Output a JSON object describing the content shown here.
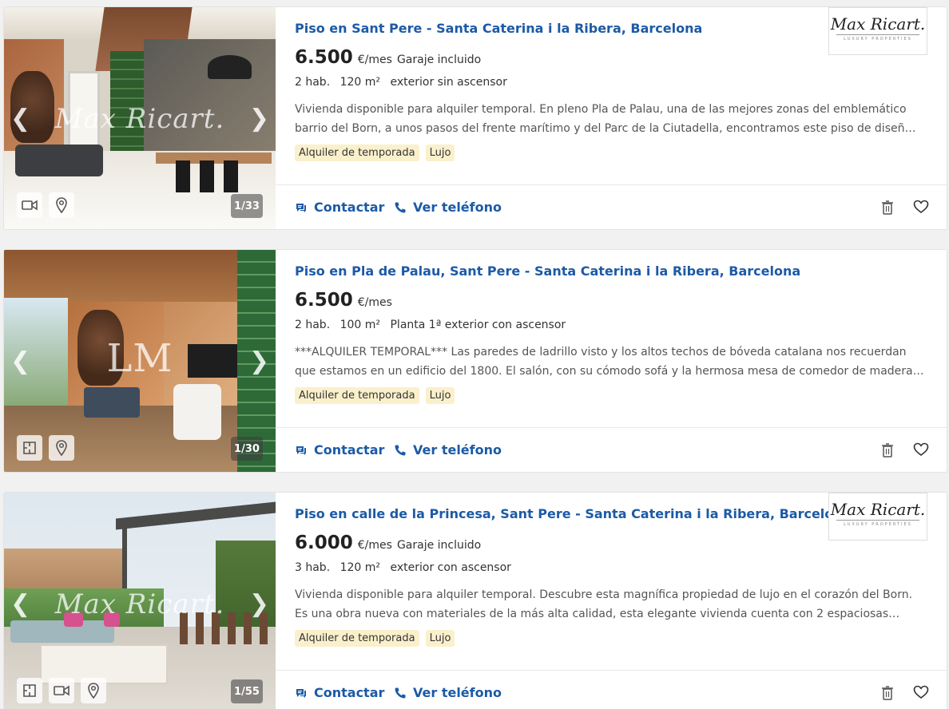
{
  "listings": [
    {
      "title": "Piso en Sant Pere - Santa Caterina i la Ribera, Barcelona",
      "price": "6.500",
      "price_unit": "€/mes",
      "price_extra": "Garaje incluido",
      "details": [
        "2 hab.",
        "120 m²",
        "exterior sin ascensor"
      ],
      "description": "Vivienda disponible para alquiler temporal. En pleno Pla de Palau, una de las mejores zonas del emblemático barrio del Born, a unos pasos del frente marítimo y del Parc de la Ciutadella, encontramos este piso de diseñ…",
      "tags": [
        "Alquiler de temporada",
        "Lujo"
      ],
      "photo_counter": "1/33",
      "watermark": "Max Ricart.",
      "logo": {
        "name": "Max Ricart.",
        "tagline": "LUXURY PROPERTIES"
      },
      "photo_icons": [
        "video-icon",
        "map-pin-icon"
      ]
    },
    {
      "title": "Piso en Pla de Palau, Sant Pere - Santa Caterina i la Ribera, Barcelona",
      "price": "6.500",
      "price_unit": "€/mes",
      "price_extra": "",
      "details": [
        "2 hab.",
        "100 m²",
        "Planta 1ª exterior con ascensor"
      ],
      "description": "***ALQUILER TEMPORAL*** Las paredes de ladrillo visto y los altos techos de bóveda catalana nos recuerdan que estamos en un edificio del 1800. El salón, con su cómodo sofá y la hermosa mesa de comedor de madera…",
      "tags": [
        "Alquiler de temporada",
        "Lujo"
      ],
      "photo_counter": "1/30",
      "watermark": "LM",
      "logo": null,
      "photo_icons": [
        "floor-plan-icon",
        "map-pin-icon"
      ]
    },
    {
      "title": "Piso en calle de la Princesa, Sant Pere - Santa Caterina i la Ribera, Barcelona",
      "price": "6.000",
      "price_unit": "€/mes",
      "price_extra": "Garaje incluido",
      "details": [
        "3 hab.",
        "120 m²",
        "exterior con ascensor"
      ],
      "description": "Vivienda disponible para alquiler temporal. Descubre esta magnífica propiedad de lujo en el corazón del Born. Es una obra nueva con materiales de la más alta calidad, esta elegante vivienda cuenta con 2 espaciosas…",
      "tags": [
        "Alquiler de temporada",
        "Lujo"
      ],
      "photo_counter": "1/55",
      "watermark": "Max Ricart.",
      "logo": {
        "name": "Max Ricart.",
        "tagline": "LUXURY PROPERTIES"
      },
      "photo_icons": [
        "floor-plan-icon",
        "video-icon",
        "map-pin-icon"
      ]
    }
  ],
  "actions": {
    "contact_label": "Contactar",
    "phone_label": "Ver teléfono"
  },
  "colors": {
    "link_blue": "#1c5aa6",
    "tag_bg": "#fbf0cc",
    "page_bg": "#f1f1f1"
  }
}
